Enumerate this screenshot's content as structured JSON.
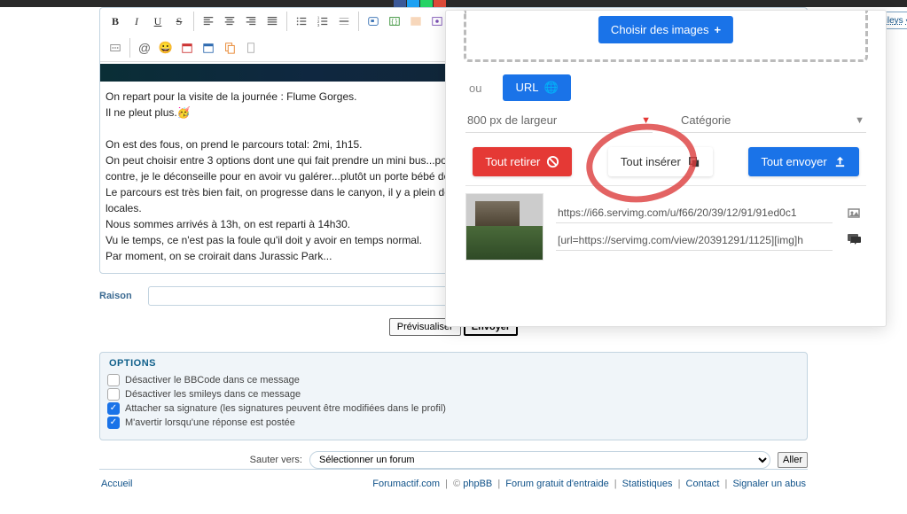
{
  "smiley_box_label": "Voir plus de smileys",
  "editor_content": {
    "l1": "On repart pour la visite de la journée : Flume Gorges.",
    "l2": "Il ne pleut plus.",
    "l4": "On est des fous, on prend le parcours total: 2mi, 1h15.",
    "l5": "On peut choisir entre 3 options dont une qui fait prendre un mini bus...po",
    "l6": "contre, je le déconseille pour en avoir vu galérer...plutôt un porte bébé do",
    "l7": "Le parcours est très bien fait, on progresse dans le canyon, il y a plein de",
    "l8": "locales.",
    "l9": "Nous sommes arrivés à 13h, on est reparti à 14h30.",
    "l10": "Vu le temps, ce n'est pas la foule qu'il doit y avoir en temps normal.",
    "l11": "Par moment, on se croirait dans Jurassic Park..."
  },
  "raison_label": "Raison",
  "preview_btn": "Prévisualiser",
  "submit_btn": "Envoyer",
  "options": {
    "title": "OPTIONS",
    "o1": "Désactiver le BBCode dans ce message",
    "o2": "Désactiver les smileys dans ce message",
    "o3": "Attacher sa signature (les signatures peuvent être modifiées dans le profil)",
    "o4": "M'avertir lorsqu'une réponse est postée"
  },
  "jump_label": "Sauter vers:",
  "jump_placeholder": "Sélectionner un forum",
  "jump_go": "Aller",
  "footer": {
    "home": "Accueil",
    "f1": "Forumactif.com",
    "sep_pipe": " | ",
    "copy": "© ",
    "f2": "phpBB",
    "f3": "Forum gratuit d'entraide",
    "f4": "Statistiques",
    "f5": "Contact",
    "f6": "Signaler un abus"
  },
  "uploader": {
    "choose": "Choisir des images",
    "ou": "ou",
    "url": "URL",
    "width_opt": "800 px de largeur",
    "cat_opt": "Catégorie",
    "remove_all": "Tout retirer",
    "insert_all": "Tout insérer",
    "send_all": "Tout envoyer",
    "row_url": "https://i66.servimg.com/u/f66/20/39/12/91/91ed0c1",
    "row_bb": "[url=https://servimg.com/view/20391291/1125][img]h"
  }
}
